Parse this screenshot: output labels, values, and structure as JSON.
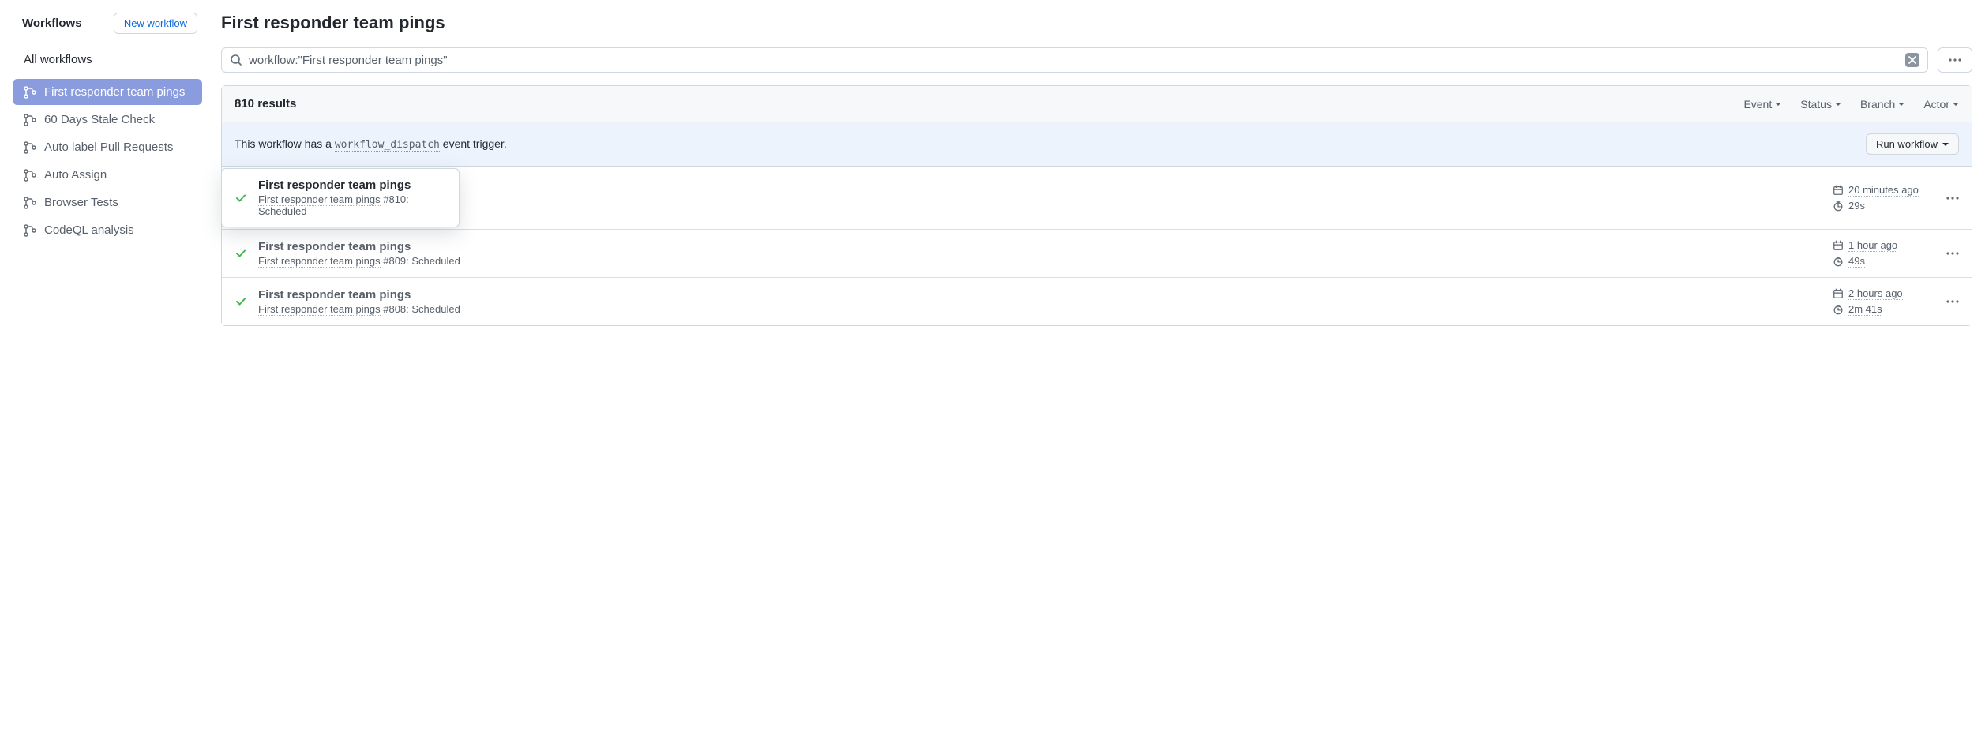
{
  "sidebar": {
    "title": "Workflows",
    "new_workflow_label": "New workflow",
    "all_label": "All workflows",
    "items": [
      {
        "label": "First responder team pings",
        "active": true
      },
      {
        "label": "60 Days Stale Check",
        "active": false
      },
      {
        "label": "Auto label Pull Requests",
        "active": false
      },
      {
        "label": "Auto Assign",
        "active": false
      },
      {
        "label": "Browser Tests",
        "active": false
      },
      {
        "label": "CodeQL analysis",
        "active": false
      }
    ]
  },
  "page_title": "First responder team pings",
  "search": {
    "value": "workflow:\"First responder team pings\""
  },
  "results_count": "810 results",
  "filters": {
    "event": "Event",
    "status": "Status",
    "branch": "Branch",
    "actor": "Actor"
  },
  "dispatch": {
    "prefix": "This workflow has a ",
    "code": "workflow_dispatch",
    "suffix": " event trigger.",
    "run_label": "Run workflow"
  },
  "runs": [
    {
      "title": "First responder team pings",
      "workflow": "First responder team pings",
      "run_tail": " #810: Scheduled",
      "time": "20 minutes ago",
      "duration": "29s",
      "highlighted": true
    },
    {
      "title": "First responder team pings",
      "workflow": "First responder team pings",
      "run_tail": " #809: Scheduled",
      "time": "1 hour ago",
      "duration": "49s",
      "highlighted": false
    },
    {
      "title": "First responder team pings",
      "workflow": "First responder team pings",
      "run_tail": " #808: Scheduled",
      "time": "2 hours ago",
      "duration": "2m 41s",
      "highlighted": false
    }
  ]
}
